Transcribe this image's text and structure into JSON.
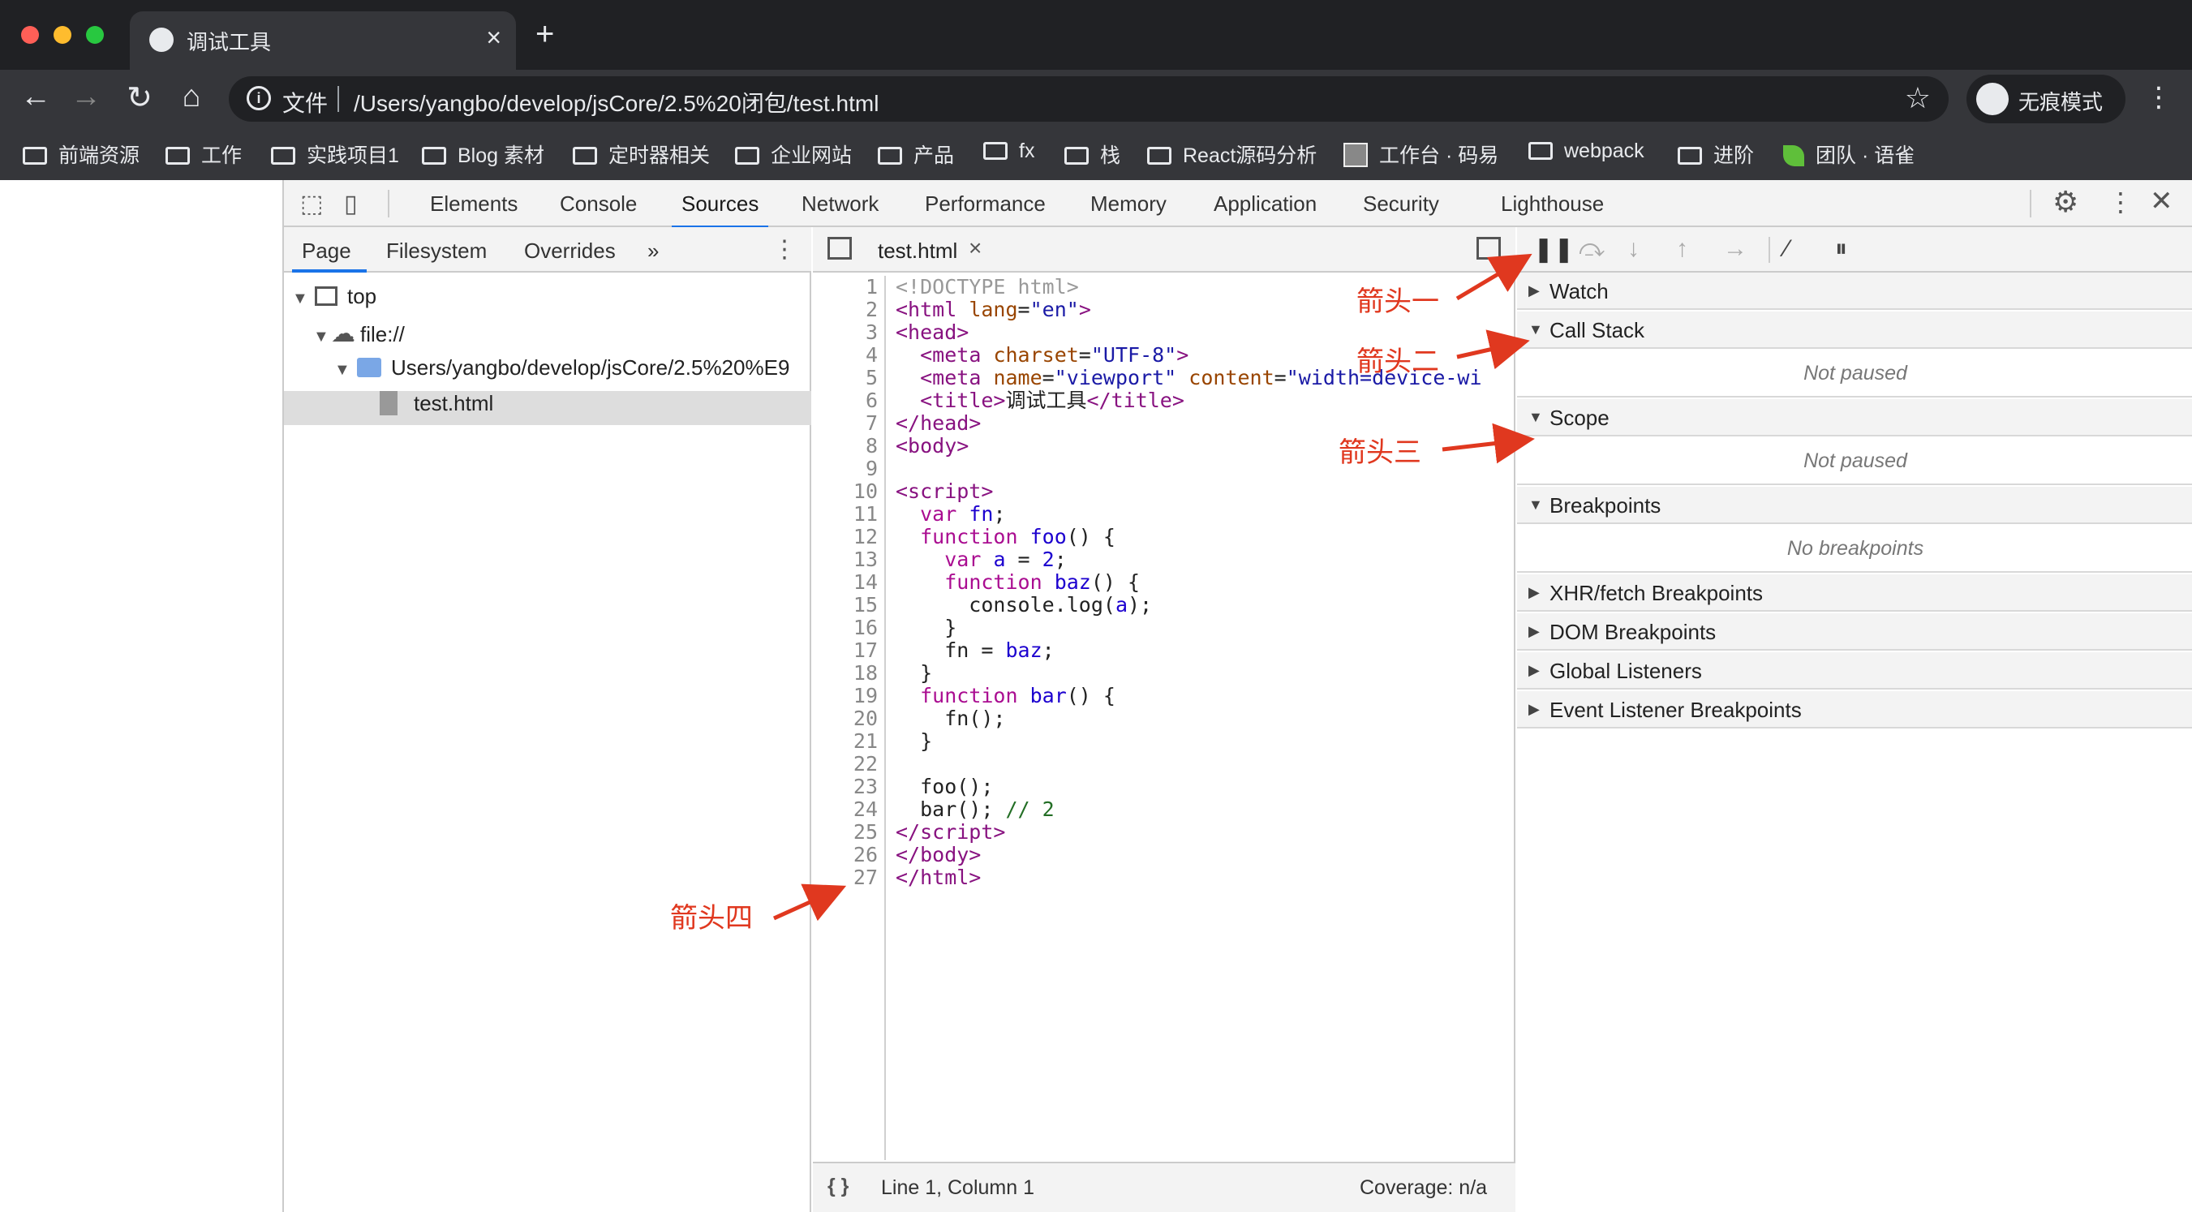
{
  "browser": {
    "tab_title": "调试工具",
    "address": {
      "file_label": "文件",
      "url": "/Users/yangbo/develop/jsCore/2.5%20闭包/test.html"
    },
    "incognito_label": "无痕模式",
    "bookmarks": [
      {
        "label": "前端资源",
        "icon": "folder-icon"
      },
      {
        "label": "工作",
        "icon": "folder-icon"
      },
      {
        "label": "实践项目1",
        "icon": "folder-icon"
      },
      {
        "label": "Blog 素材",
        "icon": "folder-icon"
      },
      {
        "label": "定时器相关",
        "icon": "folder-icon"
      },
      {
        "label": "企业网站",
        "icon": "folder-icon"
      },
      {
        "label": "产品",
        "icon": "folder-icon"
      },
      {
        "label": "fx",
        "icon": "folder-icon"
      },
      {
        "label": "栈",
        "icon": "folder-icon"
      },
      {
        "label": "React源码分析",
        "icon": "folder-icon"
      },
      {
        "label": "工作台 · 码易",
        "icon": "avatar-icon"
      },
      {
        "label": "webpack",
        "icon": "folder-icon"
      },
      {
        "label": "进阶",
        "icon": "folder-icon"
      },
      {
        "label": "团队 · 语雀",
        "icon": "leaf-icon"
      }
    ]
  },
  "devtools": {
    "tabs": [
      "Elements",
      "Console",
      "Sources",
      "Network",
      "Performance",
      "Memory",
      "Application",
      "Security",
      "Lighthouse"
    ],
    "active_tab": "Sources",
    "navigator": {
      "tabs": [
        "Page",
        "Filesystem",
        "Overrides",
        "»"
      ],
      "tree": {
        "top": "top",
        "origin": "file://",
        "folder": "Users/yangbo/develop/jsCore/2.5%20%E9",
        "file": "test.html"
      }
    },
    "editor": {
      "file_tab": "test.html",
      "status": {
        "format": "{ }",
        "position": "Line 1, Column 1",
        "coverage": "Coverage: n/a"
      }
    },
    "debugger": {
      "sections": {
        "watch": "Watch",
        "call_stack": "Call Stack",
        "call_stack_empty": "Not paused",
        "scope": "Scope",
        "scope_empty": "Not paused",
        "breakpoints": "Breakpoints",
        "breakpoints_empty": "No breakpoints",
        "xhr": "XHR/fetch Breakpoints",
        "dom": "DOM Breakpoints",
        "global": "Global Listeners",
        "event": "Event Listener Breakpoints"
      }
    }
  },
  "annotations": {
    "a1": "箭头一",
    "a2": "箭头二",
    "a3": "箭头三",
    "a4": "箭头四"
  },
  "colors": {
    "accent": "#1a73e8",
    "annotation": "#e0381f"
  }
}
